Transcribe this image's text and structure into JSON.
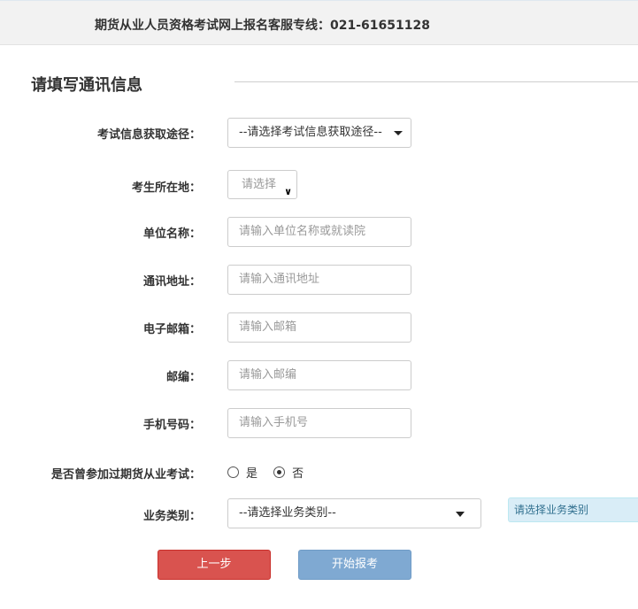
{
  "header": {
    "hotline": "期货从业人员资格考试网上报名客服专线：021-61651128"
  },
  "section": {
    "title": "请填写通讯信息"
  },
  "form": {
    "info_source": {
      "label": "考试信息获取途径：",
      "selected": "--请选择考试信息获取途径--"
    },
    "region": {
      "label": "考生所在地：",
      "selected": "请选择"
    },
    "company": {
      "label": "单位名称：",
      "placeholder": "请输入单位名称或就读院"
    },
    "address": {
      "label": "通讯地址：",
      "placeholder": "请输入通讯地址"
    },
    "email": {
      "label": "电子邮箱：",
      "placeholder": "请输入邮箱"
    },
    "postcode": {
      "label": "邮编：",
      "placeholder": "请输入邮编"
    },
    "mobile": {
      "label": "手机号码：",
      "placeholder": "请输入手机号"
    },
    "previous_exam": {
      "label": "是否曾参加过期货从业考试：",
      "options": [
        {
          "label": "是",
          "checked": false
        },
        {
          "label": "否",
          "checked": true
        }
      ]
    },
    "business_type": {
      "label": "业务类别：",
      "selected": "--请选择业务类别--",
      "hint": "请选择业务类别"
    }
  },
  "buttons": {
    "prev": "上一步",
    "start": "开始报考"
  },
  "colors": {
    "prev_button": "#d9534f",
    "start_button": "#7fa9d2",
    "hint_background": "#d9edf7"
  },
  "icons": {
    "dropdown": "caret-down-icon",
    "region_dropdown": "chevron-down-icon"
  }
}
